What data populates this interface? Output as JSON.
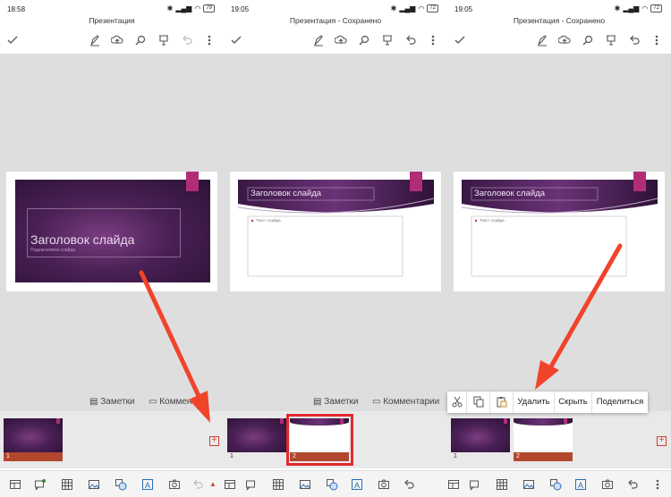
{
  "colors": {
    "accent": "#b3472d",
    "arrow": "#f0442a",
    "selection": "#e0292c",
    "slide_dark": "#2a1236",
    "slide_mid": "#7b3d82",
    "magenta_tab": "#b22d78"
  },
  "panels": [
    {
      "time": "18:58",
      "battery": "79",
      "title": "Презентация",
      "slide_title": "Заголовок слайда",
      "slide_subtitle": "Подзаголовок слайда",
      "notes_label": "Заметки",
      "comments_label": "Комменти",
      "thumb_numbers": [
        "1"
      ]
    },
    {
      "time": "19:05",
      "battery": "72",
      "title": "Презентация - Сохранено",
      "slide_title": "Заголовок слайда",
      "slide_bullet": "Текст слайда",
      "notes_label": "Заметки",
      "comments_label": "Комментарии",
      "thumb_numbers": [
        "1",
        "2"
      ]
    },
    {
      "time": "19:05",
      "battery": "72",
      "title": "Презентация - Сохранено",
      "slide_title": "Заголовок слайда",
      "slide_bullet": "Текст слайда",
      "thumb_numbers": [
        "1",
        "2"
      ]
    }
  ],
  "context_menu": {
    "delete": "Удалить",
    "hide": "Скрыть",
    "share": "Поделиться"
  },
  "add_symbol": "+",
  "icons": {
    "toolbar": [
      "checkmark-icon",
      "pen-icon",
      "cloud-upload-icon",
      "search-icon",
      "present-icon",
      "undo-icon",
      "more-vertical-icon"
    ],
    "bottom": [
      "layout-icon",
      "comment-icon",
      "table-icon",
      "picture-icon",
      "shapes-icon",
      "textbox-icon",
      "camera-icon",
      "undo-icon"
    ]
  }
}
